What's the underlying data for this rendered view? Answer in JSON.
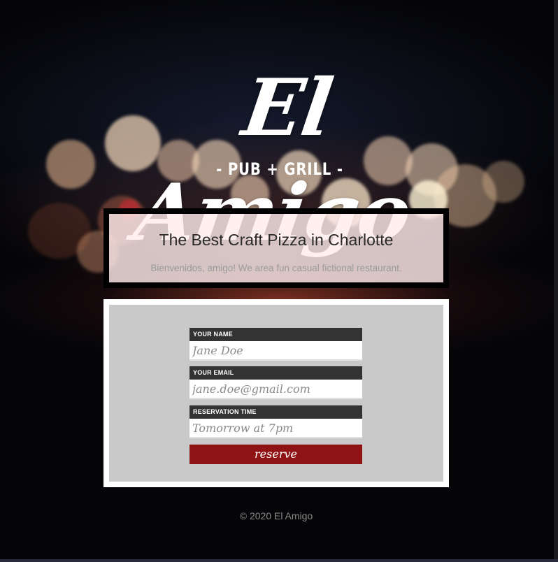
{
  "brand": {
    "logo_script": "El Amigo",
    "logo_sub": "- PUB + GRILL -"
  },
  "hero": {
    "title": "The Best Craft Pizza in Charlotte",
    "subtitle": "Bienvenidos, amigo! We area fun casual fictional restaurant."
  },
  "form": {
    "name_label": "YOUR NAME",
    "name_placeholder": "Jane Doe",
    "email_label": "YOUR EMAIL",
    "email_placeholder": "jane.doe@gmail.com",
    "time_label": "RESERVATION TIME",
    "time_placeholder": "Tomorrow at 7pm",
    "submit_label": "reserve"
  },
  "footer": {
    "copyright": "© 2020 El Amigo"
  },
  "colors": {
    "button_bg": "#8f1315",
    "label_bg": "#333333",
    "form_bg": "#c9c9c9"
  }
}
